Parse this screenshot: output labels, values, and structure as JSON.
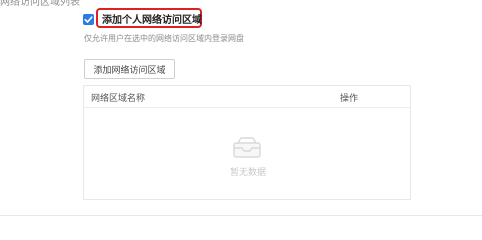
{
  "section": {
    "title": "网络访问区域列表"
  },
  "personal_network": {
    "checked": true,
    "label": "添加个人网络访问区域",
    "helper": "仅允许用户在选中的网络访问区域内登录网盘"
  },
  "actions": {
    "add_button_label": "添加网络访问区域"
  },
  "table": {
    "columns": [
      "网络区域名称",
      "操作"
    ],
    "empty_text": "暂无数据"
  },
  "colors": {
    "accent": "#2c7be5",
    "highlight": "#e02020"
  }
}
